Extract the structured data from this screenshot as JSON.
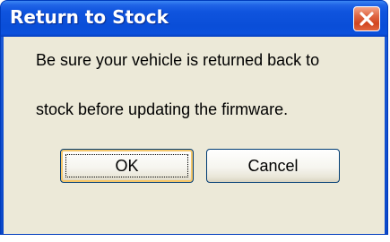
{
  "dialog": {
    "title": "Return to Stock",
    "message_lines": [
      "Be sure your vehicle is returned back to",
      "stock before updating the firmware."
    ],
    "buttons": {
      "ok_label": "OK",
      "cancel_label": "Cancel"
    }
  },
  "icons": {
    "close": "close-icon"
  },
  "colors": {
    "titlebar": "#0a4ed8",
    "client_background": "#ece9d8",
    "close_button": "#d2451f",
    "default_button_highlight": "#f5c76a"
  }
}
